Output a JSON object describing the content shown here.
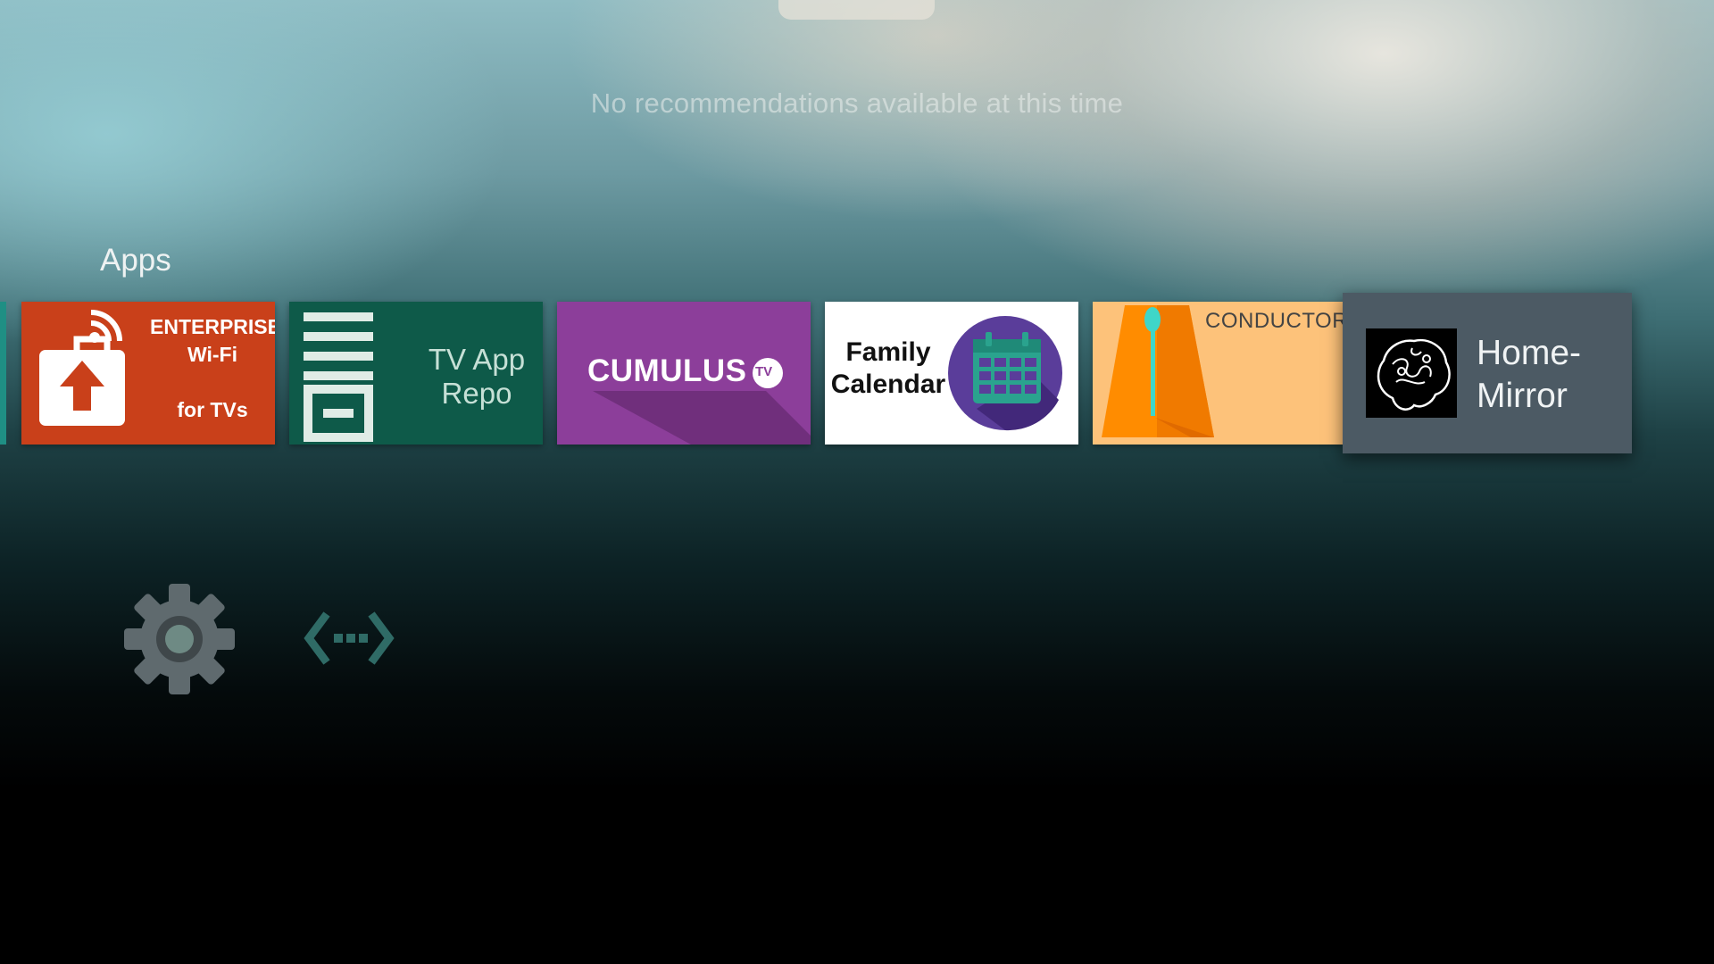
{
  "top_tab": {
    "label": ""
  },
  "recommendations": {
    "empty_message": "No recommendations available at this time"
  },
  "apps_row": {
    "title": "Apps",
    "items": [
      {
        "name": "Enterprise Wi-Fi for TVs",
        "lines": [
          "ENTERPRISE",
          "Wi-Fi",
          "for TVs"
        ],
        "color": "#c9401a"
      },
      {
        "name": "TV App Repo",
        "lines": [
          "TV App",
          "Repo"
        ],
        "color": "#0e5a49"
      },
      {
        "name": "Cumulus TV",
        "lines": [
          "CUMULUS",
          "TV"
        ],
        "color": "#8c3e9a"
      },
      {
        "name": "Family Calendar",
        "lines": [
          "Family",
          "Calendar"
        ],
        "color": "#ffffff"
      },
      {
        "name": "Conductor",
        "lines": [
          "CONDUCTOR"
        ],
        "color": "#fdc27a"
      },
      {
        "name": "Home-Mirror",
        "lines": [
          "Home-",
          "Mirror"
        ],
        "color": "#4c5a64",
        "focused": true
      }
    ]
  },
  "bottom_icons": [
    {
      "icon": "gear-icon",
      "label": "Settings"
    },
    {
      "icon": "network-icon",
      "label": "Network"
    }
  ]
}
